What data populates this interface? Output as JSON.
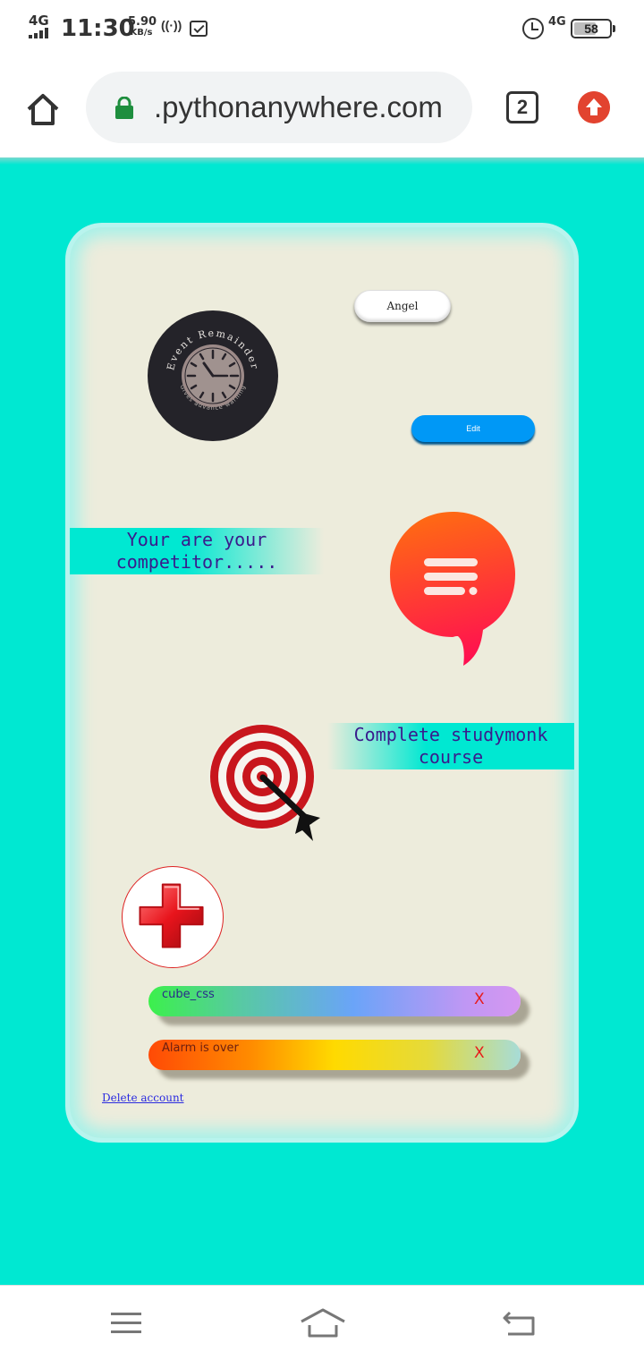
{
  "status_bar": {
    "network": "4G",
    "time": "11:30",
    "speed_value": "5.90",
    "speed_unit": "KB/s",
    "network_right": "4G",
    "battery_level": "58",
    "icons": [
      "signal-icon",
      "hotspot-icon",
      "mail-icon",
      "alarm-icon",
      "battery-icon"
    ]
  },
  "browser": {
    "url": ".pythonanywhere.com",
    "tab_count": "2",
    "icons": [
      "home-icon",
      "lock-icon",
      "tabs-icon",
      "update-icon"
    ],
    "colors": {
      "lock": "#1e8e3e",
      "update": "#e2432f",
      "url_bar": "#f1f3f4"
    }
  },
  "page": {
    "background": "#00e8d2",
    "logo": {
      "title": "Event Remainder",
      "subtitle": "Gives advance warning"
    },
    "user_button": "Angel",
    "edit_button": "Edit",
    "quote": {
      "line1": "Your are your",
      "line2": "competitor....."
    },
    "goal": {
      "line1": "Complete studymonk",
      "line2": "course"
    },
    "events": [
      {
        "label": "cube_css",
        "remove": "X"
      },
      {
        "label": "Alarm is over",
        "remove": "X"
      }
    ],
    "delete_link": "Delete account",
    "icons": [
      "chat-icon",
      "target-icon",
      "plus-icon"
    ]
  },
  "nav_bar": {
    "icons": [
      "menu-icon",
      "home-icon",
      "back-icon"
    ]
  }
}
